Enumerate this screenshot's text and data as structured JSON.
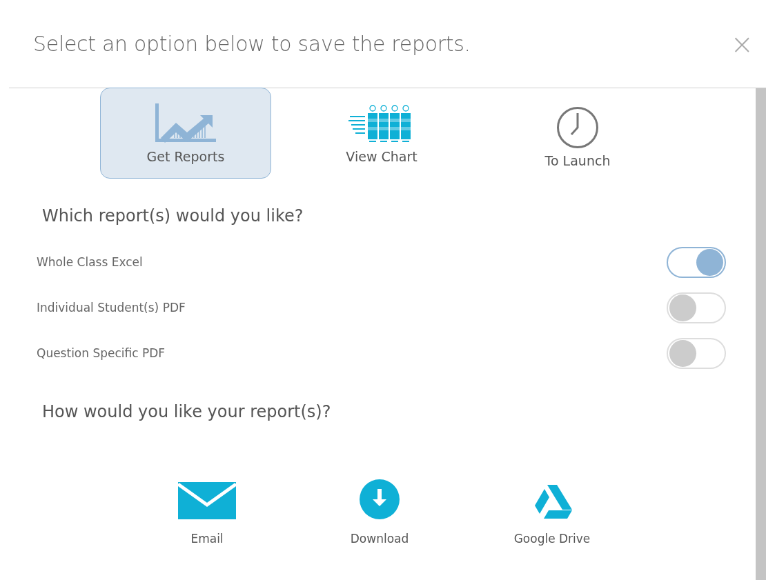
{
  "dialog": {
    "title": "Select an option below to save the reports.",
    "close": "×"
  },
  "tabs": [
    {
      "label": "Get Reports",
      "kind": "trend",
      "selected": true
    },
    {
      "label": "View Chart",
      "kind": "chart",
      "selected": false
    },
    {
      "label": "To Launch",
      "kind": "clock",
      "selected": false
    }
  ],
  "report_section": {
    "heading": "Which report(s) would you like?",
    "options": [
      {
        "label": "Whole Class Excel",
        "on": true
      },
      {
        "label": "Individual Student(s) PDF",
        "on": false
      },
      {
        "label": "Question Specific PDF",
        "on": false
      }
    ]
  },
  "delivery_section": {
    "heading": "How would you like your report(s)?",
    "options": [
      {
        "label": "Email",
        "kind": "email"
      },
      {
        "label": "Download",
        "kind": "download"
      },
      {
        "label": "Google Drive",
        "kind": "drive"
      }
    ]
  }
}
